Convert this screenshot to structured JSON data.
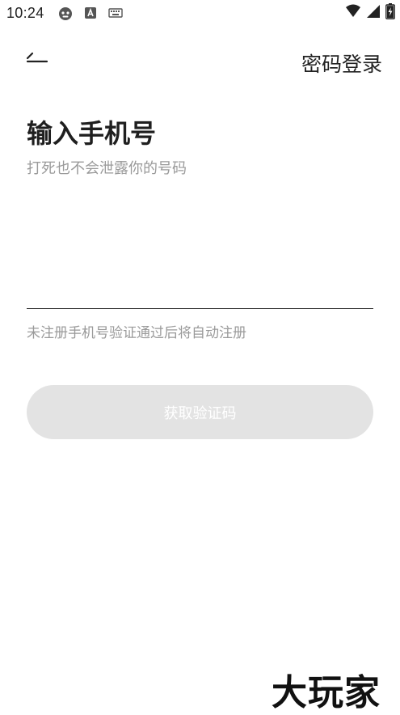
{
  "status_bar": {
    "time": "10:24",
    "icons": [
      "robot-notification-icon",
      "a-app-icon",
      "keyboard-icon",
      "wifi-icon",
      "signal-icon",
      "battery-charging-icon"
    ]
  },
  "header": {
    "back_icon": "back-arrow-icon",
    "password_login_label": "密码登录"
  },
  "main": {
    "title": "输入手机号",
    "subtitle": "打死也不会泄露你的号码",
    "phone_input": {
      "value": "",
      "placeholder": ""
    },
    "hint": "未注册手机号验证通过后将自动注册",
    "get_code_button": "获取验证码"
  },
  "watermark": "大玩家",
  "colors": {
    "background": "#ffffff",
    "button_disabled_bg": "#e3e3e3",
    "button_text": "#ffffff",
    "secondary_text": "#9a9a9a",
    "primary_text": "#222222"
  }
}
